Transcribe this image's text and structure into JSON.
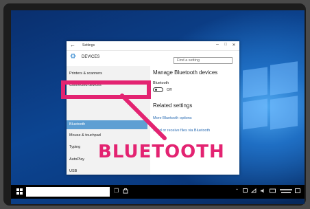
{
  "window": {
    "title": "Settings",
    "header": "DEVICES",
    "search_placeholder": "Find a setting",
    "controls": {
      "minimize": "–",
      "maximize": "□",
      "close": "✕"
    },
    "back": "←"
  },
  "sidebar": {
    "items": [
      {
        "label": "Printers & scanners"
      },
      {
        "label": "Connected devices"
      },
      {
        "label": "Bluetooth"
      },
      {
        "label": "Mouse & touchpad"
      },
      {
        "label": "Typing"
      },
      {
        "label": "AutoPlay"
      },
      {
        "label": "USB"
      }
    ],
    "selected_index": 2
  },
  "content": {
    "heading": "Manage Bluetooth devices",
    "toggle_label": "Bluetooth",
    "toggle_state": "Off",
    "related_heading": "Related settings",
    "link_more": "More Bluetooth options",
    "link_send": "Send or receive files via Bluetooth"
  },
  "overlay": {
    "label": "BLUETOOTH",
    "color": "#e32371"
  },
  "icons": {
    "gear": "⚙",
    "taskview": "❐",
    "store": "🛍",
    "start": "windows-logo"
  },
  "colors": {
    "accent": "#5e9fd3",
    "highlight": "#e32371",
    "link": "#2a6cb3"
  }
}
